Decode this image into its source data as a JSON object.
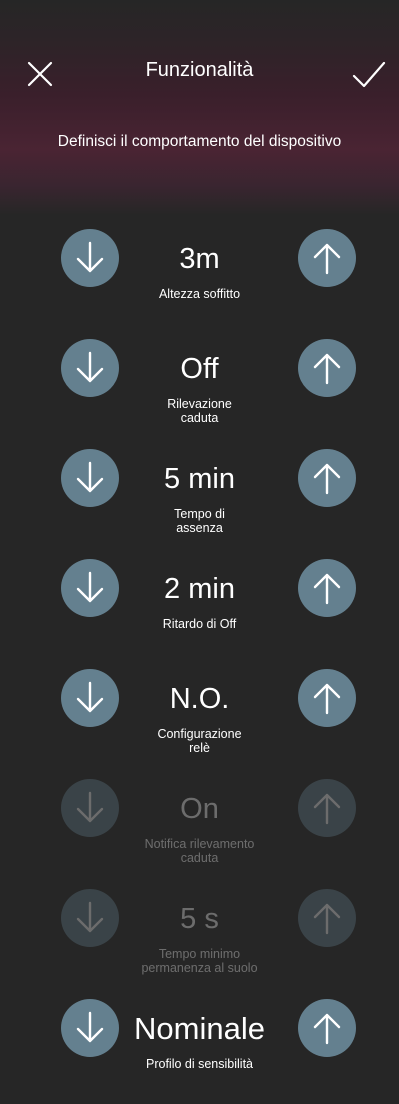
{
  "header": {
    "title": "Funzionalità",
    "subtitle": "Definisci il comportamento del dispositivo",
    "close_icon": "close-icon",
    "confirm_icon": "checkmark-icon",
    "accent_gradient": "#4a2433"
  },
  "controls": {
    "button_color": "#64808f",
    "decrease_icon": "arrow-down-icon",
    "increase_icon": "arrow-up-icon"
  },
  "settings": [
    {
      "value": "3m",
      "label": "Altezza soffitto",
      "enabled": true
    },
    {
      "value": "Off",
      "label": "Rilevazione\ncaduta",
      "enabled": true
    },
    {
      "value": "5 min",
      "label": "Tempo di\nassenza",
      "enabled": true
    },
    {
      "value": "2 min",
      "label": "Ritardo di Off",
      "enabled": true
    },
    {
      "value": "N.O.",
      "label": "Configurazione\nrelè",
      "enabled": true
    },
    {
      "value": "On",
      "label": "Notifica rilevamento\ncaduta",
      "enabled": false
    },
    {
      "value": "5 s",
      "label": "Tempo minimo\npermanenza al suolo",
      "enabled": false
    },
    {
      "value": "Nominale",
      "label": "Profilo di sensibilità",
      "enabled": true
    }
  ]
}
